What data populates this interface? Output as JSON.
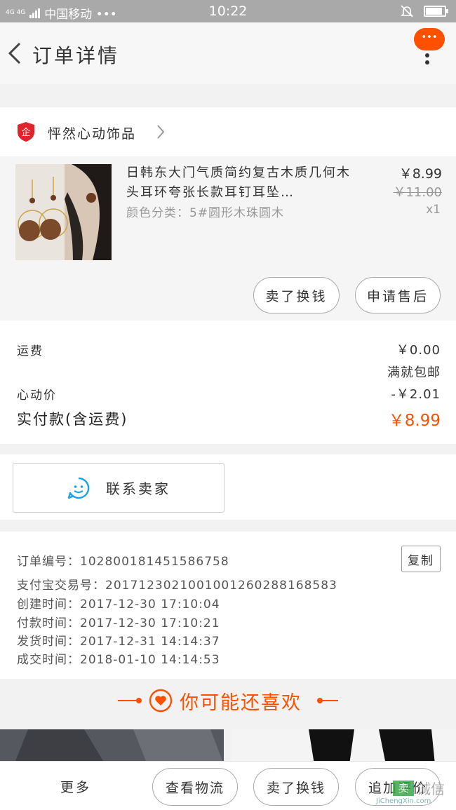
{
  "status_bar": {
    "network": "4G 4G",
    "carrier": "中国移动 •••",
    "time": "10:22",
    "battery_level": 0.9
  },
  "nav": {
    "title": "订单详情",
    "message_badge": "•••",
    "back_icon": "chevron-left-icon",
    "more_icon": "vertical-dots-icon"
  },
  "shop": {
    "badge_text": "企",
    "name": "怦然心动饰品"
  },
  "item": {
    "title": "日韩东大门气质简约复古木质几何木头耳环夸张长款耳钉耳坠…",
    "sku": "颜色分类：5#圆形木珠圆木",
    "price": "￥8.99",
    "original_price": "￥11.00",
    "quantity": "x1",
    "actions": [
      "卖了换钱",
      "申请售后"
    ]
  },
  "fees": {
    "shipping_label": "运费",
    "shipping_value": "￥0.00",
    "shipping_note": "满就包邮",
    "discount_label": "心动价",
    "discount_value": "-￥2.01",
    "total_label": "实付款(含运费)",
    "total_value": "￥8.99"
  },
  "contact": {
    "label": "联系卖家"
  },
  "order_info": {
    "copy_label": "复制",
    "lines": [
      "订单编号：102800181451586758",
      "支付宝交易号：2017123021001001260288168583",
      "创建时间：2017-12-30 17:10:04",
      "付款时间：2017-12-30 17:10:21",
      "发货时间：2017-12-31 14:14:37",
      "成交时间：2018-01-10 14:14:53"
    ]
  },
  "recommend": {
    "title": "你可能还喜欢"
  },
  "bottom_bar": {
    "more": "更多",
    "buttons": [
      "查看物流",
      "卖了换钱",
      "追加评价"
    ]
  },
  "watermark": {
    "box": "卖",
    "text": "诚信",
    "url": "JiChengXin.com"
  },
  "colors": {
    "accent": "#ff5000",
    "contact_icon": "#1aa3e8",
    "shop_badge": "#e0242b"
  }
}
